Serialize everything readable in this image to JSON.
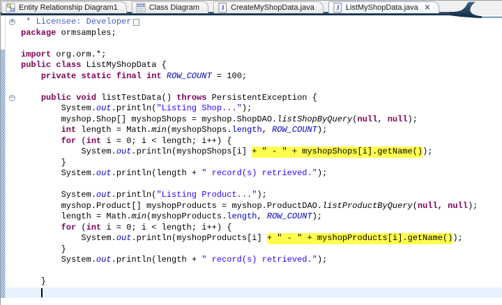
{
  "tabs": [
    {
      "label": "Entity Relationship Diagram1",
      "icon": "erd-icon",
      "active": false
    },
    {
      "label": "Class Diagram",
      "icon": "class-diagram-icon",
      "active": false
    },
    {
      "label": "CreateMyShopData.java",
      "icon": "java-file-icon",
      "active": false
    },
    {
      "label": "ListMyShopData.java",
      "icon": "java-file-icon",
      "active": true
    }
  ],
  "icons": {
    "close_glyph": "✕",
    "fold_collapsed_glyph": "+",
    "fold_expanded_glyph": "−"
  },
  "colors": {
    "keyword": "#7f0055",
    "string": "#2a00ff",
    "javadoc": "#3f5fbf",
    "field": "#0000c0",
    "highlight_bg": "#ffff4d",
    "current_line_bg": "#e8f2fe",
    "diff_dark": "#7ea8d8",
    "diff_light": "#c6dcf4",
    "tab_band_top": "#3e5f80",
    "tab_band_bottom": "#122b44",
    "tab_line": "#8fa8c4"
  },
  "editor": {
    "diff_from_line": 4,
    "lines": [
      {
        "fold": "plus",
        "box": true,
        "seg": [
          [
            "j",
            " * Licensee: Developer"
          ]
        ]
      },
      {
        "seg": [
          [
            "k",
            "package"
          ],
          [
            "p",
            " ormsamples;"
          ]
        ]
      },
      {
        "seg": []
      },
      {
        "seg": [
          [
            "k",
            "import"
          ],
          [
            "p",
            " org.orm.*;"
          ]
        ]
      },
      {
        "seg": [
          [
            "k",
            "public"
          ],
          [
            "p",
            " "
          ],
          [
            "k",
            "class"
          ],
          [
            "p",
            " ListMyShopData {"
          ]
        ]
      },
      {
        "seg": [
          [
            "p",
            "    "
          ],
          [
            "k",
            "private"
          ],
          [
            "p",
            " "
          ],
          [
            "k",
            "static"
          ],
          [
            "p",
            " "
          ],
          [
            "k",
            "final"
          ],
          [
            "p",
            " "
          ],
          [
            "k",
            "int"
          ],
          [
            "p",
            " "
          ],
          [
            "sf",
            "ROW_COUNT"
          ],
          [
            "p",
            " = 100;"
          ]
        ]
      },
      {
        "seg": []
      },
      {
        "fold": "minus",
        "seg": [
          [
            "p",
            "    "
          ],
          [
            "k",
            "public"
          ],
          [
            "p",
            " "
          ],
          [
            "k",
            "void"
          ],
          [
            "p",
            " listTestData() "
          ],
          [
            "k",
            "throws"
          ],
          [
            "p",
            " PersistentException {"
          ]
        ]
      },
      {
        "seg": [
          [
            "p",
            "        System."
          ],
          [
            "sf",
            "out"
          ],
          [
            "p",
            ".println("
          ],
          [
            "s",
            "\"Listing Shop...\""
          ],
          [
            "p",
            ");"
          ]
        ]
      },
      {
        "seg": [
          [
            "p",
            "        myshop.Shop[] myshopShops = myshop.ShopDAO."
          ],
          [
            "m",
            "listShopByQuery"
          ],
          [
            "p",
            "("
          ],
          [
            "k",
            "null"
          ],
          [
            "p",
            ", "
          ],
          [
            "k",
            "null"
          ],
          [
            "p",
            ");"
          ]
        ]
      },
      {
        "seg": [
          [
            "p",
            "        "
          ],
          [
            "k",
            "int"
          ],
          [
            "p",
            " length = Math."
          ],
          [
            "m",
            "min"
          ],
          [
            "p",
            "(myshopShops."
          ],
          [
            "fd",
            "length"
          ],
          [
            "p",
            ", "
          ],
          [
            "sf",
            "ROW_COUNT"
          ],
          [
            "p",
            ");"
          ]
        ]
      },
      {
        "seg": [
          [
            "p",
            "        "
          ],
          [
            "k",
            "for"
          ],
          [
            "p",
            " ("
          ],
          [
            "k",
            "int"
          ],
          [
            "p",
            " i = 0; i < length; i++) {"
          ]
        ]
      },
      {
        "seg": [
          [
            "p",
            "            System."
          ],
          [
            "sf",
            "out"
          ],
          [
            "p",
            ".println(myshopShops[i] "
          ],
          [
            "h",
            "+ \" - \" + myshopShops[i].getName()"
          ],
          [
            "p",
            ");"
          ]
        ]
      },
      {
        "seg": [
          [
            "p",
            "        }"
          ]
        ]
      },
      {
        "seg": [
          [
            "p",
            "        System."
          ],
          [
            "sf",
            "out"
          ],
          [
            "p",
            ".println(length + "
          ],
          [
            "s",
            "\" record(s) retrieved.\""
          ],
          [
            "p",
            ");"
          ]
        ]
      },
      {
        "seg": []
      },
      {
        "seg": [
          [
            "p",
            "        System."
          ],
          [
            "sf",
            "out"
          ],
          [
            "p",
            ".println("
          ],
          [
            "s",
            "\"Listing Product...\""
          ],
          [
            "p",
            ");"
          ]
        ]
      },
      {
        "seg": [
          [
            "p",
            "        myshop.Product[] myshopProducts = myshop.ProductDAO."
          ],
          [
            "m",
            "listProductByQuery"
          ],
          [
            "p",
            "("
          ],
          [
            "k",
            "null"
          ],
          [
            "p",
            ", "
          ],
          [
            "k",
            "null"
          ],
          [
            "p",
            ");"
          ]
        ]
      },
      {
        "seg": [
          [
            "p",
            "        length = Math."
          ],
          [
            "m",
            "min"
          ],
          [
            "p",
            "(myshopProducts."
          ],
          [
            "fd",
            "length"
          ],
          [
            "p",
            ", "
          ],
          [
            "sf",
            "ROW_COUNT"
          ],
          [
            "p",
            ");"
          ]
        ]
      },
      {
        "seg": [
          [
            "p",
            "        "
          ],
          [
            "k",
            "for"
          ],
          [
            "p",
            " ("
          ],
          [
            "k",
            "int"
          ],
          [
            "p",
            " i = 0; i < length; i++) {"
          ]
        ]
      },
      {
        "seg": [
          [
            "p",
            "            System."
          ],
          [
            "sf",
            "out"
          ],
          [
            "p",
            ".println(myshopProducts[i] "
          ],
          [
            "h",
            "+ \" - \" + myshopProducts[i].getName()"
          ],
          [
            "p",
            ");"
          ]
        ]
      },
      {
        "seg": [
          [
            "p",
            "        }"
          ]
        ]
      },
      {
        "seg": [
          [
            "p",
            "        System."
          ],
          [
            "sf",
            "out"
          ],
          [
            "p",
            ".println(length + "
          ],
          [
            "s",
            "\" record(s) retrieved.\""
          ],
          [
            "p",
            ");"
          ]
        ]
      },
      {
        "seg": []
      },
      {
        "seg": [
          [
            "p",
            "    }"
          ]
        ]
      },
      {
        "current": true,
        "caret": true,
        "seg": [
          [
            "p",
            "    "
          ]
        ]
      }
    ]
  }
}
